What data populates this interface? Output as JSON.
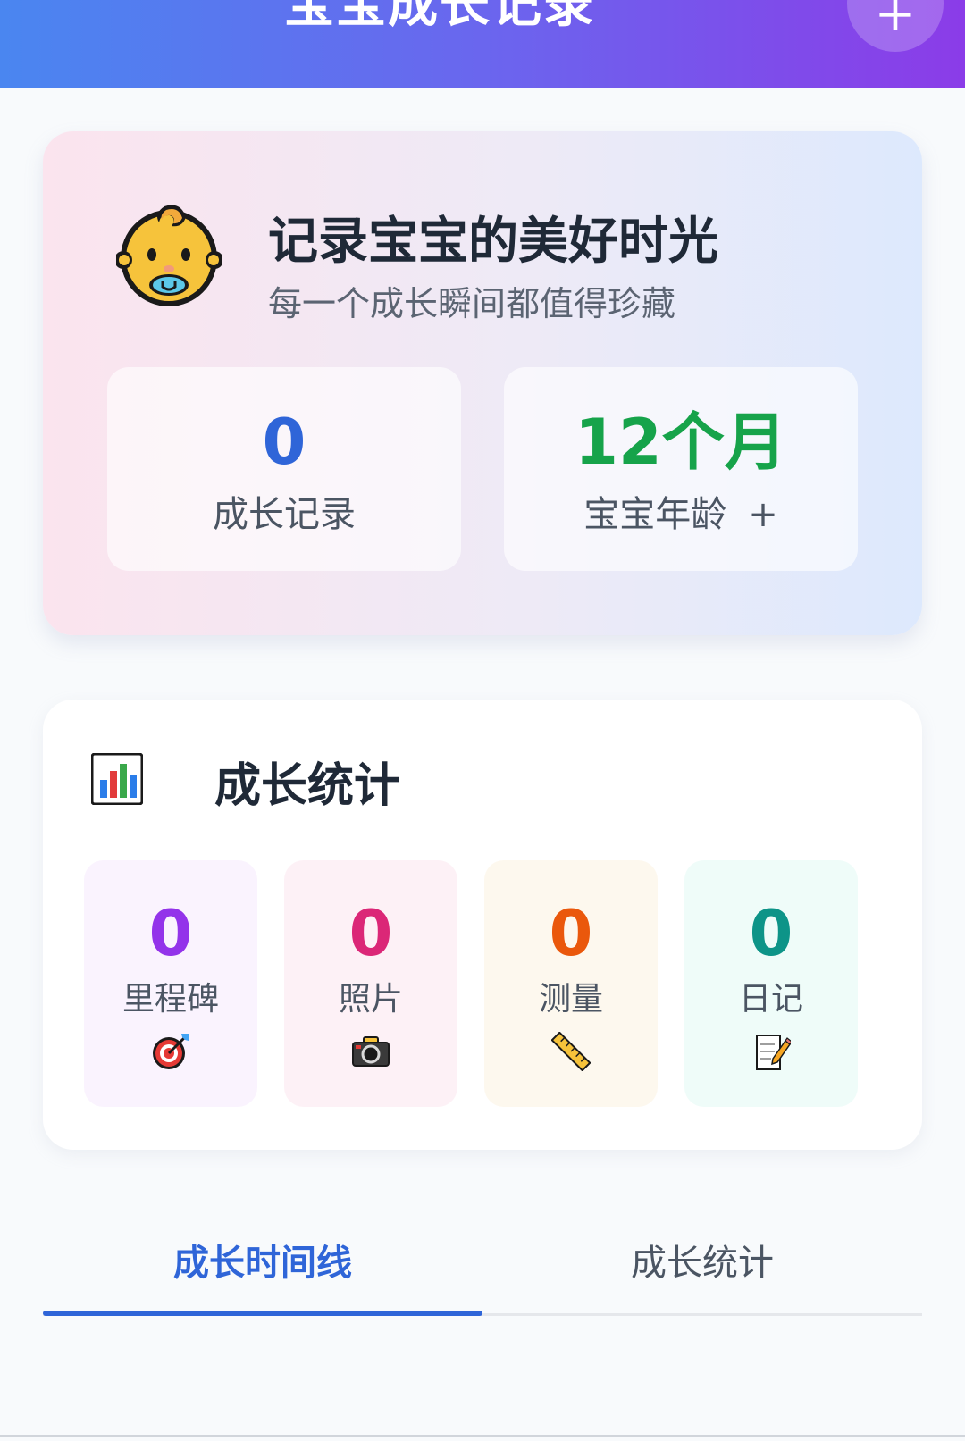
{
  "header": {
    "title": "宝宝成长记录",
    "add_label": "+"
  },
  "hero": {
    "title": "记录宝宝的美好时光",
    "subtitle": "每一个成长瞬间都值得珍藏",
    "records": {
      "value": "0",
      "label": "成长记录",
      "color": "#2f65d8"
    },
    "age": {
      "value": "12个月",
      "label": "宝宝年龄",
      "plus": "+",
      "color": "#16a34a"
    }
  },
  "stats": {
    "title": "成长统计",
    "title_icon": "bar-chart-icon",
    "items": [
      {
        "value": "0",
        "label": "里程碑",
        "icon": "target-icon",
        "color": "#9333ea",
        "bg": "#faf3fe"
      },
      {
        "value": "0",
        "label": "照片",
        "icon": "camera-icon",
        "color": "#db2777",
        "bg": "#fdf1f6"
      },
      {
        "value": "0",
        "label": "测量",
        "icon": "ruler-icon",
        "color": "#ea580c",
        "bg": "#fdf8ee"
      },
      {
        "value": "0",
        "label": "日记",
        "icon": "memo-icon",
        "color": "#0d9488",
        "bg": "#effcf9"
      }
    ]
  },
  "tabs": [
    {
      "label": "成长时间线",
      "active": true
    },
    {
      "label": "成长统计",
      "active": false
    }
  ]
}
